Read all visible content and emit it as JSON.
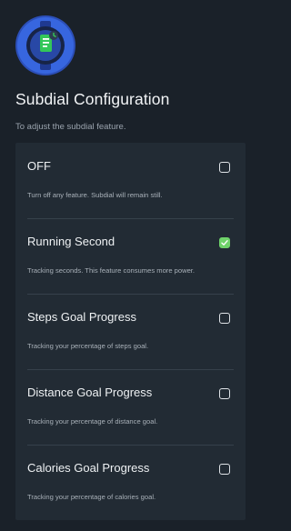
{
  "header": {
    "icon": "watch-subdial-icon",
    "title": "Subdial Configuration",
    "subtitle": "To adjust the subdial feature."
  },
  "options": [
    {
      "title": "OFF",
      "description": "Turn off any feature. Subdial will remain still.",
      "checked": false
    },
    {
      "title": "Running Second",
      "description": "Tracking seconds. This feature consumes more power.",
      "checked": true
    },
    {
      "title": "Steps Goal Progress",
      "description": "Tracking your percentage of steps goal.",
      "checked": false
    },
    {
      "title": "Distance Goal Progress",
      "description": "Tracking your percentage of distance goal.",
      "checked": false
    },
    {
      "title": "Calories Goal Progress",
      "description": "Tracking your percentage of calories goal.",
      "checked": false
    }
  ],
  "colors": {
    "background": "#1a2129",
    "card": "#222b34",
    "checked": "#6fd36a",
    "icon_blue": "#2f5fd8",
    "icon_green": "#34c759"
  }
}
